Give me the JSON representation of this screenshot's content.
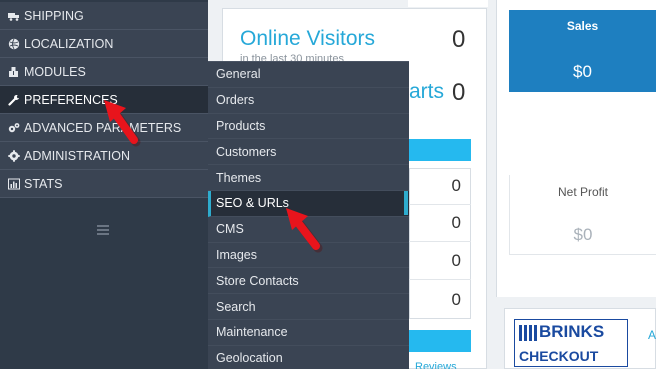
{
  "sidebar": {
    "items": [
      {
        "label": "SHIPPING",
        "icon": "truck-icon",
        "active": false
      },
      {
        "label": "LOCALIZATION",
        "icon": "globe-icon",
        "active": false
      },
      {
        "label": "MODULES",
        "icon": "puzzle-icon",
        "active": false
      },
      {
        "label": "PREFERENCES",
        "icon": "wrench-icon",
        "active": true
      },
      {
        "label": "ADVANCED PARAMETERS",
        "icon": "cogs-icon",
        "active": false
      },
      {
        "label": "ADMINISTRATION",
        "icon": "gear-icon",
        "active": false
      },
      {
        "label": "STATS",
        "icon": "bar-chart-icon",
        "active": false
      }
    ],
    "collapse_icon": "hamburger-icon"
  },
  "submenu": {
    "items": [
      {
        "label": "General"
      },
      {
        "label": "Orders"
      },
      {
        "label": "Products"
      },
      {
        "label": "Customers"
      },
      {
        "label": "Themes"
      },
      {
        "label": "SEO & URLs"
      },
      {
        "label": "CMS"
      },
      {
        "label": "Images"
      },
      {
        "label": "Store Contacts"
      },
      {
        "label": "Search"
      },
      {
        "label": "Maintenance"
      },
      {
        "label": "Geolocation"
      }
    ],
    "active": "SEO & URLs"
  },
  "dashboard": {
    "online_visitors": {
      "title": "Online Visitors",
      "subtitle": "in the last 30 minutes",
      "value": "0"
    },
    "active_carts": {
      "title_visible": "arts",
      "value": "0"
    },
    "rows": [
      "0",
      "0",
      "0",
      "0"
    ],
    "reviews_link": "Reviews",
    "sales": {
      "label": "Sales",
      "value": "$0"
    },
    "net_profit": {
      "label": "Net Profit",
      "value": "$0"
    },
    "brinks": {
      "word": "BRINKS",
      "sub": "CHECKOUT",
      "side_text": "A"
    }
  },
  "colors": {
    "sidebar_bg": "#3a4453",
    "sidebar_active": "#262e39",
    "accent_blue": "#26a8d8",
    "bar_blue": "#25b9ef",
    "sales_blue": "#1e7fc0",
    "arrow_red": "#e8141c"
  }
}
